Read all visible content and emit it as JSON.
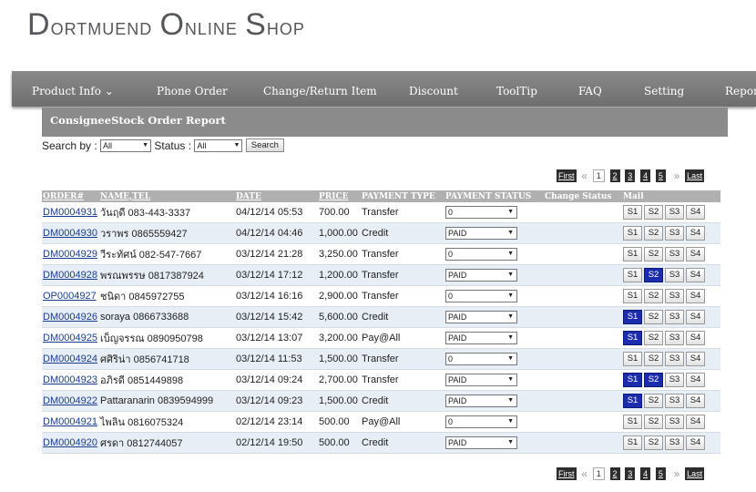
{
  "shop_title_initials": [
    "D",
    "O",
    "S"
  ],
  "shop_title_parts": [
    "ortmuend ",
    "nline ",
    "hop"
  ],
  "nav": [
    {
      "label": "Product Info",
      "has_caret": true,
      "caret": "⌄"
    },
    {
      "label": "Phone Order"
    },
    {
      "label": "Change/Return Item"
    },
    {
      "label": "Discount"
    },
    {
      "label": "ToolTip"
    },
    {
      "label": "FAQ"
    },
    {
      "label": "Setting"
    },
    {
      "label": "Repor"
    }
  ],
  "report_title": "ConsigneeStock Order Report",
  "search": {
    "search_by_label": "Search by :",
    "search_by_value": "All",
    "status_label": "Status :",
    "status_value": "All",
    "button": "Search"
  },
  "pager": {
    "first": "First",
    "last": "Last",
    "prev": "«",
    "next": "»",
    "pages": [
      "1",
      "2",
      "3",
      "4",
      "5"
    ],
    "current": "1"
  },
  "columns": [
    "ORDER#",
    "NAME,TEL",
    "DATE",
    "PRICE",
    "PAYMENT TYPE",
    "PAYMENT STATUS",
    "Change Status",
    "Mail"
  ],
  "mail_buttons": [
    "S1",
    "S2",
    "S3",
    "S4"
  ],
  "rows": [
    {
      "order": "DM0004931",
      "name_tel": "วันฤดี 083-443-3337",
      "date": "04/12/14 05:53",
      "price": "700.00",
      "payment_type": "Transfer",
      "status": "0",
      "mail_on": []
    },
    {
      "order": "DM0004930",
      "name_tel": "วราพร 0865559427",
      "date": "04/12/14 04:46",
      "price": "1,000.00",
      "payment_type": "Credit",
      "status": "PAID",
      "mail_on": []
    },
    {
      "order": "DM0004929",
      "name_tel": "วีระทัศน์ 082-547-7667",
      "date": "03/12/14 21:28",
      "price": "3,250.00",
      "payment_type": "Transfer",
      "status": "0",
      "mail_on": []
    },
    {
      "order": "DM0004928",
      "name_tel": "พรณพรรษ 0817387924",
      "date": "03/12/14 17:12",
      "price": "1,200.00",
      "payment_type": "Transfer",
      "status": "PAID",
      "mail_on": [
        "S2"
      ]
    },
    {
      "order": "OP0004927",
      "name_tel": "ชนิดา 0845972755",
      "date": "03/12/14 16:16",
      "price": "2,900.00",
      "payment_type": "Transfer",
      "status": "0",
      "mail_on": []
    },
    {
      "order": "DM0004926",
      "name_tel": "soraya 0866733688",
      "date": "03/12/14 15:42",
      "price": "5,600.00",
      "payment_type": "Credit",
      "status": "PAID",
      "mail_on": [
        "S1"
      ]
    },
    {
      "order": "DM0004925",
      "name_tel": "เบ็ญจรรณ 0890950798",
      "date": "03/12/14 13:07",
      "price": "3,200.00",
      "payment_type": "Pay@All",
      "status": "PAID",
      "mail_on": [
        "S1"
      ]
    },
    {
      "order": "DM0004924",
      "name_tel": "ศศิริน่า 0856741718",
      "date": "03/12/14 11:53",
      "price": "1,500.00",
      "payment_type": "Transfer",
      "status": "0",
      "mail_on": []
    },
    {
      "order": "DM0004923",
      "name_tel": "อภิรดี 0851449898",
      "date": "03/12/14 09:24",
      "price": "2,700.00",
      "payment_type": "Transfer",
      "status": "PAID",
      "mail_on": [
        "S1",
        "S2"
      ]
    },
    {
      "order": "DM0004922",
      "name_tel": "Pattaranarin 0839594999",
      "date": "03/12/14 09:23",
      "price": "1,500.00",
      "payment_type": "Credit",
      "status": "PAID",
      "mail_on": [
        "S1"
      ]
    },
    {
      "order": "DM0004921",
      "name_tel": "ไพลิน 0816075324",
      "date": "02/12/14 23:14",
      "price": "500.00",
      "payment_type": "Pay@All",
      "status": "0",
      "mail_on": []
    },
    {
      "order": "DM0004920",
      "name_tel": "ศรดา 0812744057",
      "date": "02/12/14 19:50",
      "price": "500.00",
      "payment_type": "Credit",
      "status": "PAID",
      "mail_on": []
    }
  ],
  "colors": {
    "mail_active": "#1b2dad",
    "nav_bg": "#7d7d7d",
    "header_bg": "#8b8b8b",
    "alt_row": "#e8eef6"
  }
}
